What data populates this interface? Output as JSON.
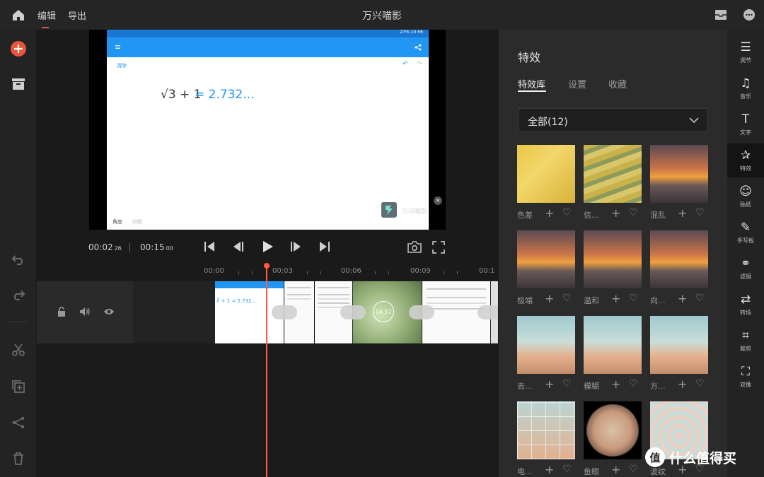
{
  "topbar": {
    "title": "万兴喵影",
    "tabs": [
      {
        "label": "编辑",
        "active": true
      },
      {
        "label": "导出",
        "active": false
      }
    ]
  },
  "preview": {
    "phone_status": "27% 10:56",
    "phone_clear": "清除",
    "phone_expression": "√3 + 1",
    "phone_result": "= 2.732...",
    "phone_bottom_left": "角度",
    "phone_bottom_mid": "分数",
    "watermark": "万兴喵影"
  },
  "playback": {
    "current": "00:02",
    "current_frac": "26",
    "total": "00:15",
    "total_frac": "00"
  },
  "ruler": {
    "ticks": [
      "00:00",
      "00:03",
      "00:06",
      "00:09",
      "00:1"
    ]
  },
  "clip": {
    "duration_badge": "14.57"
  },
  "panel": {
    "title": "特效",
    "tabs": [
      {
        "label": "特效库",
        "active": true
      },
      {
        "label": "设置",
        "active": false
      },
      {
        "label": "收藏",
        "active": false
      }
    ],
    "dropdown": "全部(12)",
    "effects": [
      {
        "name": "色差",
        "kind": "girl"
      },
      {
        "name": "信...",
        "kind": "glitch"
      },
      {
        "name": "混乱",
        "kind": "sunset"
      },
      {
        "name": "极端",
        "kind": "sunset"
      },
      {
        "name": "温和",
        "kind": "sunset"
      },
      {
        "name": "向...",
        "kind": "sunset"
      },
      {
        "name": "去...",
        "kind": "van"
      },
      {
        "name": "模糊",
        "kind": "van"
      },
      {
        "name": "方...",
        "kind": "van"
      },
      {
        "name": "电...",
        "kind": "vangrid"
      },
      {
        "name": "鱼眼",
        "kind": "fisheye"
      },
      {
        "name": "波纹",
        "kind": "ripple"
      }
    ]
  },
  "right_rail": [
    {
      "label": "调节",
      "icon": "sliders-icon"
    },
    {
      "label": "音乐",
      "icon": "music-icon"
    },
    {
      "label": "文字",
      "icon": "text-icon"
    },
    {
      "label": "特效",
      "icon": "effects-icon",
      "active": true
    },
    {
      "label": "贴纸",
      "icon": "sticker-icon"
    },
    {
      "label": "手写板",
      "icon": "handwriting-icon"
    },
    {
      "label": "滤镜",
      "icon": "filter-icon"
    },
    {
      "label": "转场",
      "icon": "transition-icon"
    },
    {
      "label": "裁剪",
      "icon": "crop-icon"
    },
    {
      "label": "双像",
      "icon": "double-icon"
    }
  ],
  "watermark_brand": "值 什么值得买",
  "colors": {
    "accent": "#e8553d",
    "blue": "#2196f3",
    "playhead": "#ff5a3d"
  }
}
